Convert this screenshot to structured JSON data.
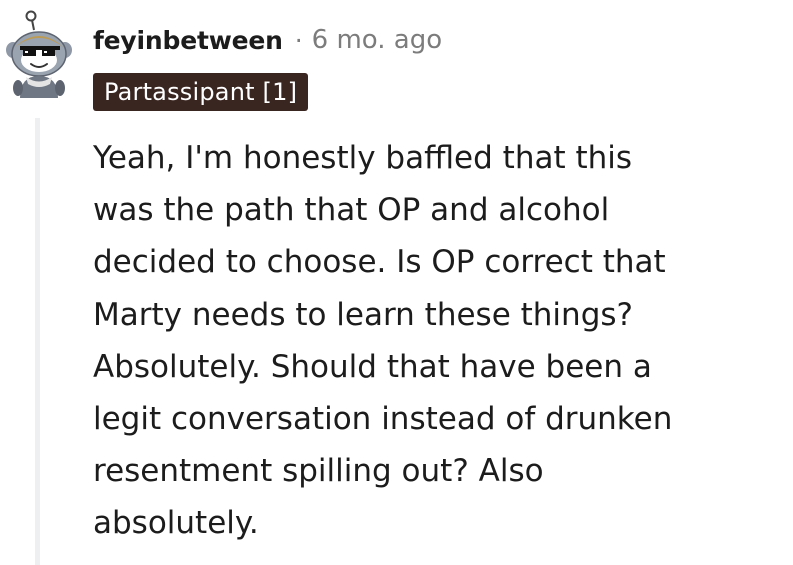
{
  "comment": {
    "author": "feyinbetween",
    "separator": "·",
    "timestamp": "6 mo. ago",
    "flair": "Partassipant [1]",
    "body_lines": [
      "Yeah, I'm honestly baffled that this",
      "was the path that OP and alcohol",
      "decided to choose. Is OP correct that",
      "Marty needs to learn these things?",
      "Absolutely. Should that have been a",
      "legit conversation instead of drunken",
      "resentment spilling out? Also",
      "absolutely."
    ]
  },
  "colors": {
    "flair_background": "#3a2621",
    "flair_text": "#ffffff",
    "meta_text": "#7c7c7c",
    "body_text": "#1c1c1c",
    "thread_line": "#edeff1"
  },
  "icons": {
    "avatar": "snoo-avatar-with-pixel-sunglasses-icon"
  }
}
